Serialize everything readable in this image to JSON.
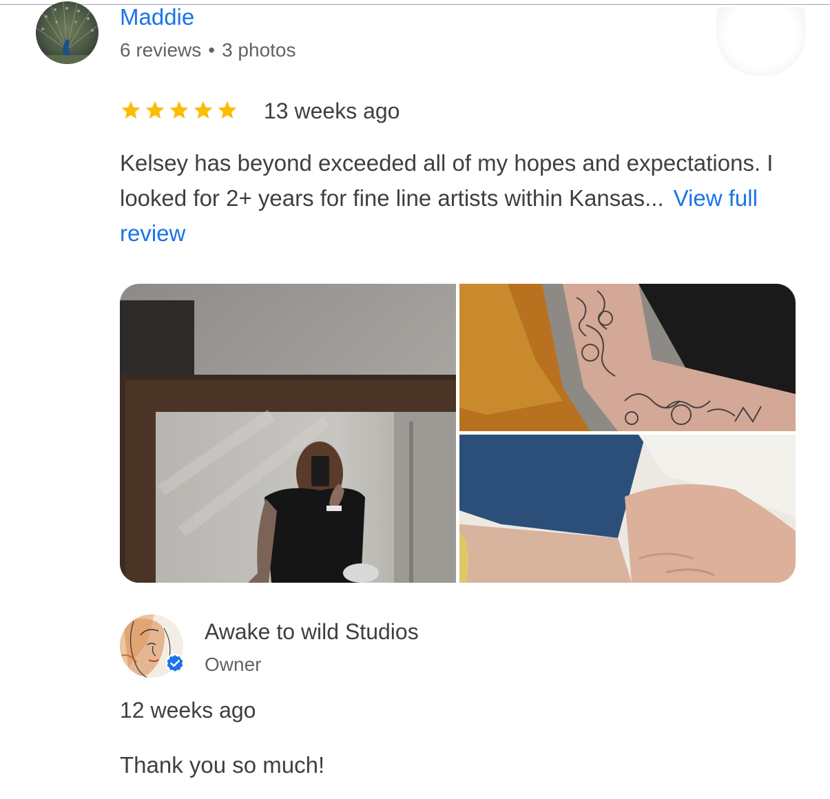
{
  "review": {
    "reviewer_name": "Maddie",
    "reviews_count": "6 reviews",
    "separator": "•",
    "photos_count": "3 photos",
    "rating": 5,
    "max_rating": 5,
    "time_ago": "13 weeks ago",
    "text": "Kelsey has beyond exceeded all of my hopes and expectations. I looked for 2+ years for fine line artists within Kansas...",
    "view_full_label": "View full review",
    "star_color": "#fbbc04"
  },
  "owner_response": {
    "name": "Awake to wild Studios",
    "role": "Owner",
    "time_ago": "12 weeks ago",
    "text": "Thank you so much!",
    "verified_color": "#1a73e8"
  },
  "icons": {
    "reviewer_avatar": "peacock-photo-avatar",
    "owner_avatar": "illustrated-face-avatar",
    "verified_badge": "verified-check-icon",
    "star": "star-icon"
  }
}
